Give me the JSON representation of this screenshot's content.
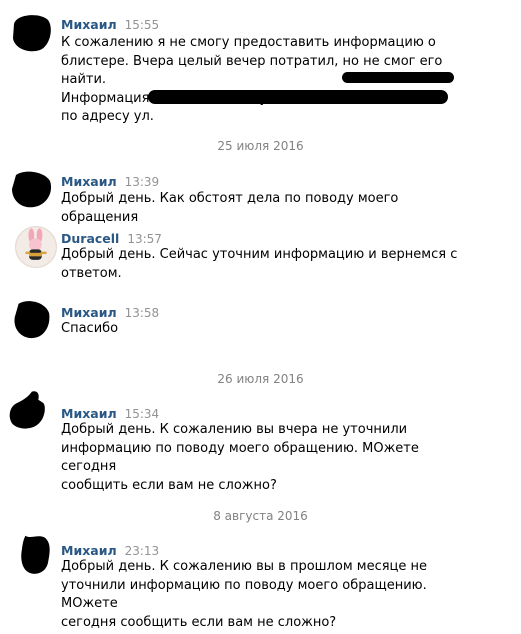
{
  "messages": [
    {
      "author": "Михаил",
      "time": "15:55",
      "lines": [
        "К сожалению я не смогу предоставить информацию о",
        "блистере. Вчера целый вечер потратил, но не смог его найти.",
        "Информация о магазине: Я купил в магазине",
        "по адресу ул."
      ]
    },
    {
      "author": "Михаил",
      "time": "13:39",
      "lines": [
        "Добрый день. Как обстоят дела по поводу моего обращения"
      ]
    },
    {
      "author": "Duracell",
      "time": "13:57",
      "lines": [
        "Добрый день. Сейчас уточним информацию и вернемся с",
        "ответом."
      ]
    },
    {
      "author": "Михаил",
      "time": "13:58",
      "lines": [
        "Спасибо"
      ]
    },
    {
      "author": "Михаил",
      "time": "15:34",
      "lines": [
        "Добрый день. К сожалению вы вчера не уточнили",
        "информацию по поводу моего обращению. МОжете сегодня",
        "сообщить если вам не сложно?"
      ]
    },
    {
      "author": "Михаил",
      "time": "23:13",
      "lines": [
        "Добрый день. К сожалению вы в прошлом месяце не",
        "уточнили информацию по поводу моего обращению. МОжете",
        "сегодня сообщить если вам не сложно?"
      ]
    }
  ],
  "dates": [
    "25 июля 2016",
    "26 июля 2016",
    "8 августа 2016"
  ],
  "colors": {
    "author": "#2a5885",
    "time": "#939393",
    "date": "#828282"
  },
  "icons": [
    "redacted-avatar",
    "duracell-bunny-avatar"
  ]
}
